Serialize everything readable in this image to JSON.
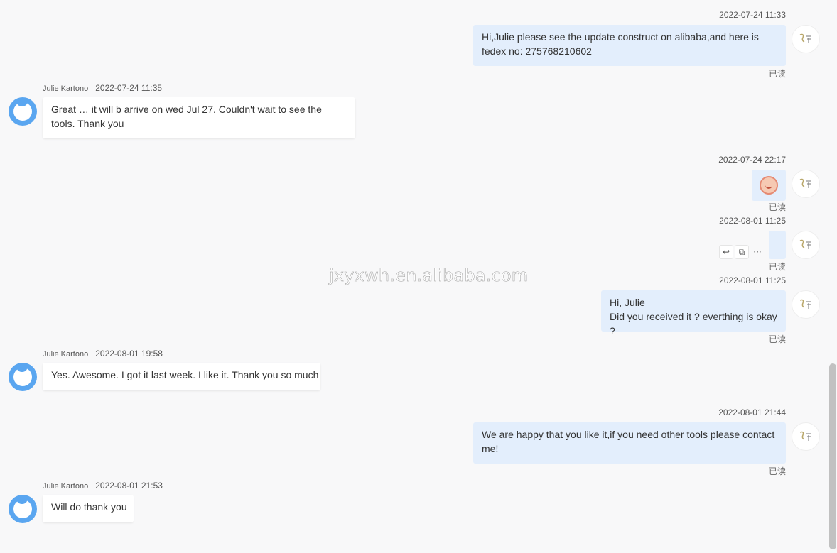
{
  "watermark": "jxyxwh.en.alibaba.com",
  "read_label": "已读",
  "messages": [
    {
      "direction": "out",
      "time": "2022-07-24 11:33",
      "text": "Hi,Julie please see the update construct on alibaba,and here is fedex no: 275768210602"
    },
    {
      "direction": "in",
      "sender": "Julie Kartono",
      "time": "2022-07-24 11:35",
      "text": "Great … it will b arrive on wed Jul 27. Couldn't wait to see the tools. Thank you"
    },
    {
      "direction": "out",
      "time": "2022-07-24 22:17",
      "type": "sticker",
      "sticker_icon": "emoji-girl-sticker-icon"
    },
    {
      "direction": "out",
      "time": "2022-08-01 11:25",
      "type": "empty"
    },
    {
      "direction": "out",
      "time": "2022-08-01 11:25",
      "text_line1": "Hi, Julie",
      "text_line2": "Did you received it ? everthing is okay ?"
    },
    {
      "direction": "in",
      "sender": "Julie Kartono",
      "time": "2022-08-01 19:58",
      "text": "Yes. Awesome. I got it last week. I like it. Thank you so much"
    },
    {
      "direction": "out",
      "time": "2022-08-01 21:44",
      "text": "We are happy that you like it,if you need other tools please contact me!"
    },
    {
      "direction": "in",
      "sender": "Julie Kartono",
      "time": "2022-08-01 21:53",
      "text": "Will do thank you"
    }
  ],
  "message_actions": {
    "reply_icon": "↩",
    "translate_icon": "⧉",
    "more_icon": "···"
  },
  "colors": {
    "outgoing_bubble": "#e3eefc",
    "incoming_bubble": "#ffffff",
    "julie_avatar": "#5aa6f0"
  }
}
